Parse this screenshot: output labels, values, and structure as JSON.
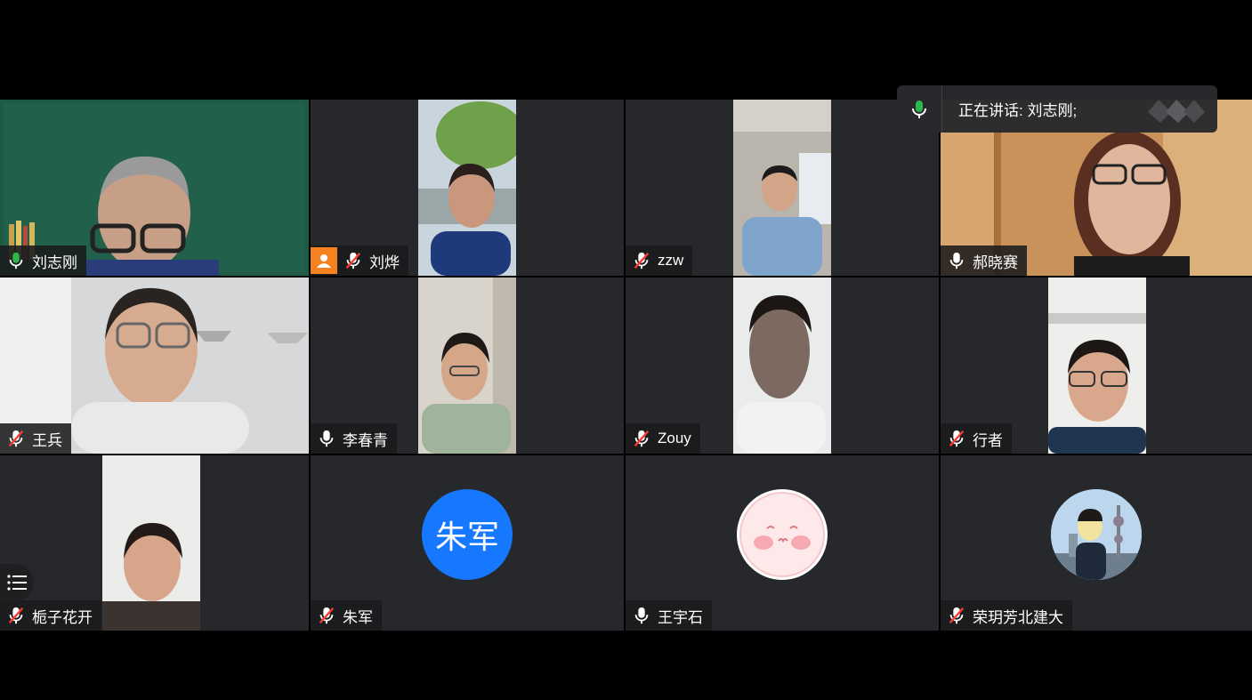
{
  "speaker_bar": {
    "label": "正在讲话: 刘志刚;"
  },
  "participants": [
    {
      "name": "刘志刚",
      "mic": "on-active"
    },
    {
      "name": "刘烨",
      "mic": "muted"
    },
    {
      "name": "zzw",
      "mic": "muted"
    },
    {
      "name": "郝晓赛",
      "mic": "on"
    },
    {
      "name": "王兵",
      "mic": "muted"
    },
    {
      "name": "李春青",
      "mic": "on"
    },
    {
      "name": "Zouy",
      "mic": "muted"
    },
    {
      "name": "行者",
      "mic": "muted"
    },
    {
      "name": "栀子花开",
      "mic": "muted"
    },
    {
      "name": "朱军",
      "mic": "muted",
      "avatar_text": "朱军"
    },
    {
      "name": "王宇石",
      "mic": "on"
    },
    {
      "name": "荣玥芳北建大",
      "mic": "muted"
    }
  ],
  "colors": {
    "active_border": "#1fb24a",
    "avatar_blue": "#1677ff",
    "mic_green": "#2db84d",
    "profile_orange": "#f5821f"
  }
}
